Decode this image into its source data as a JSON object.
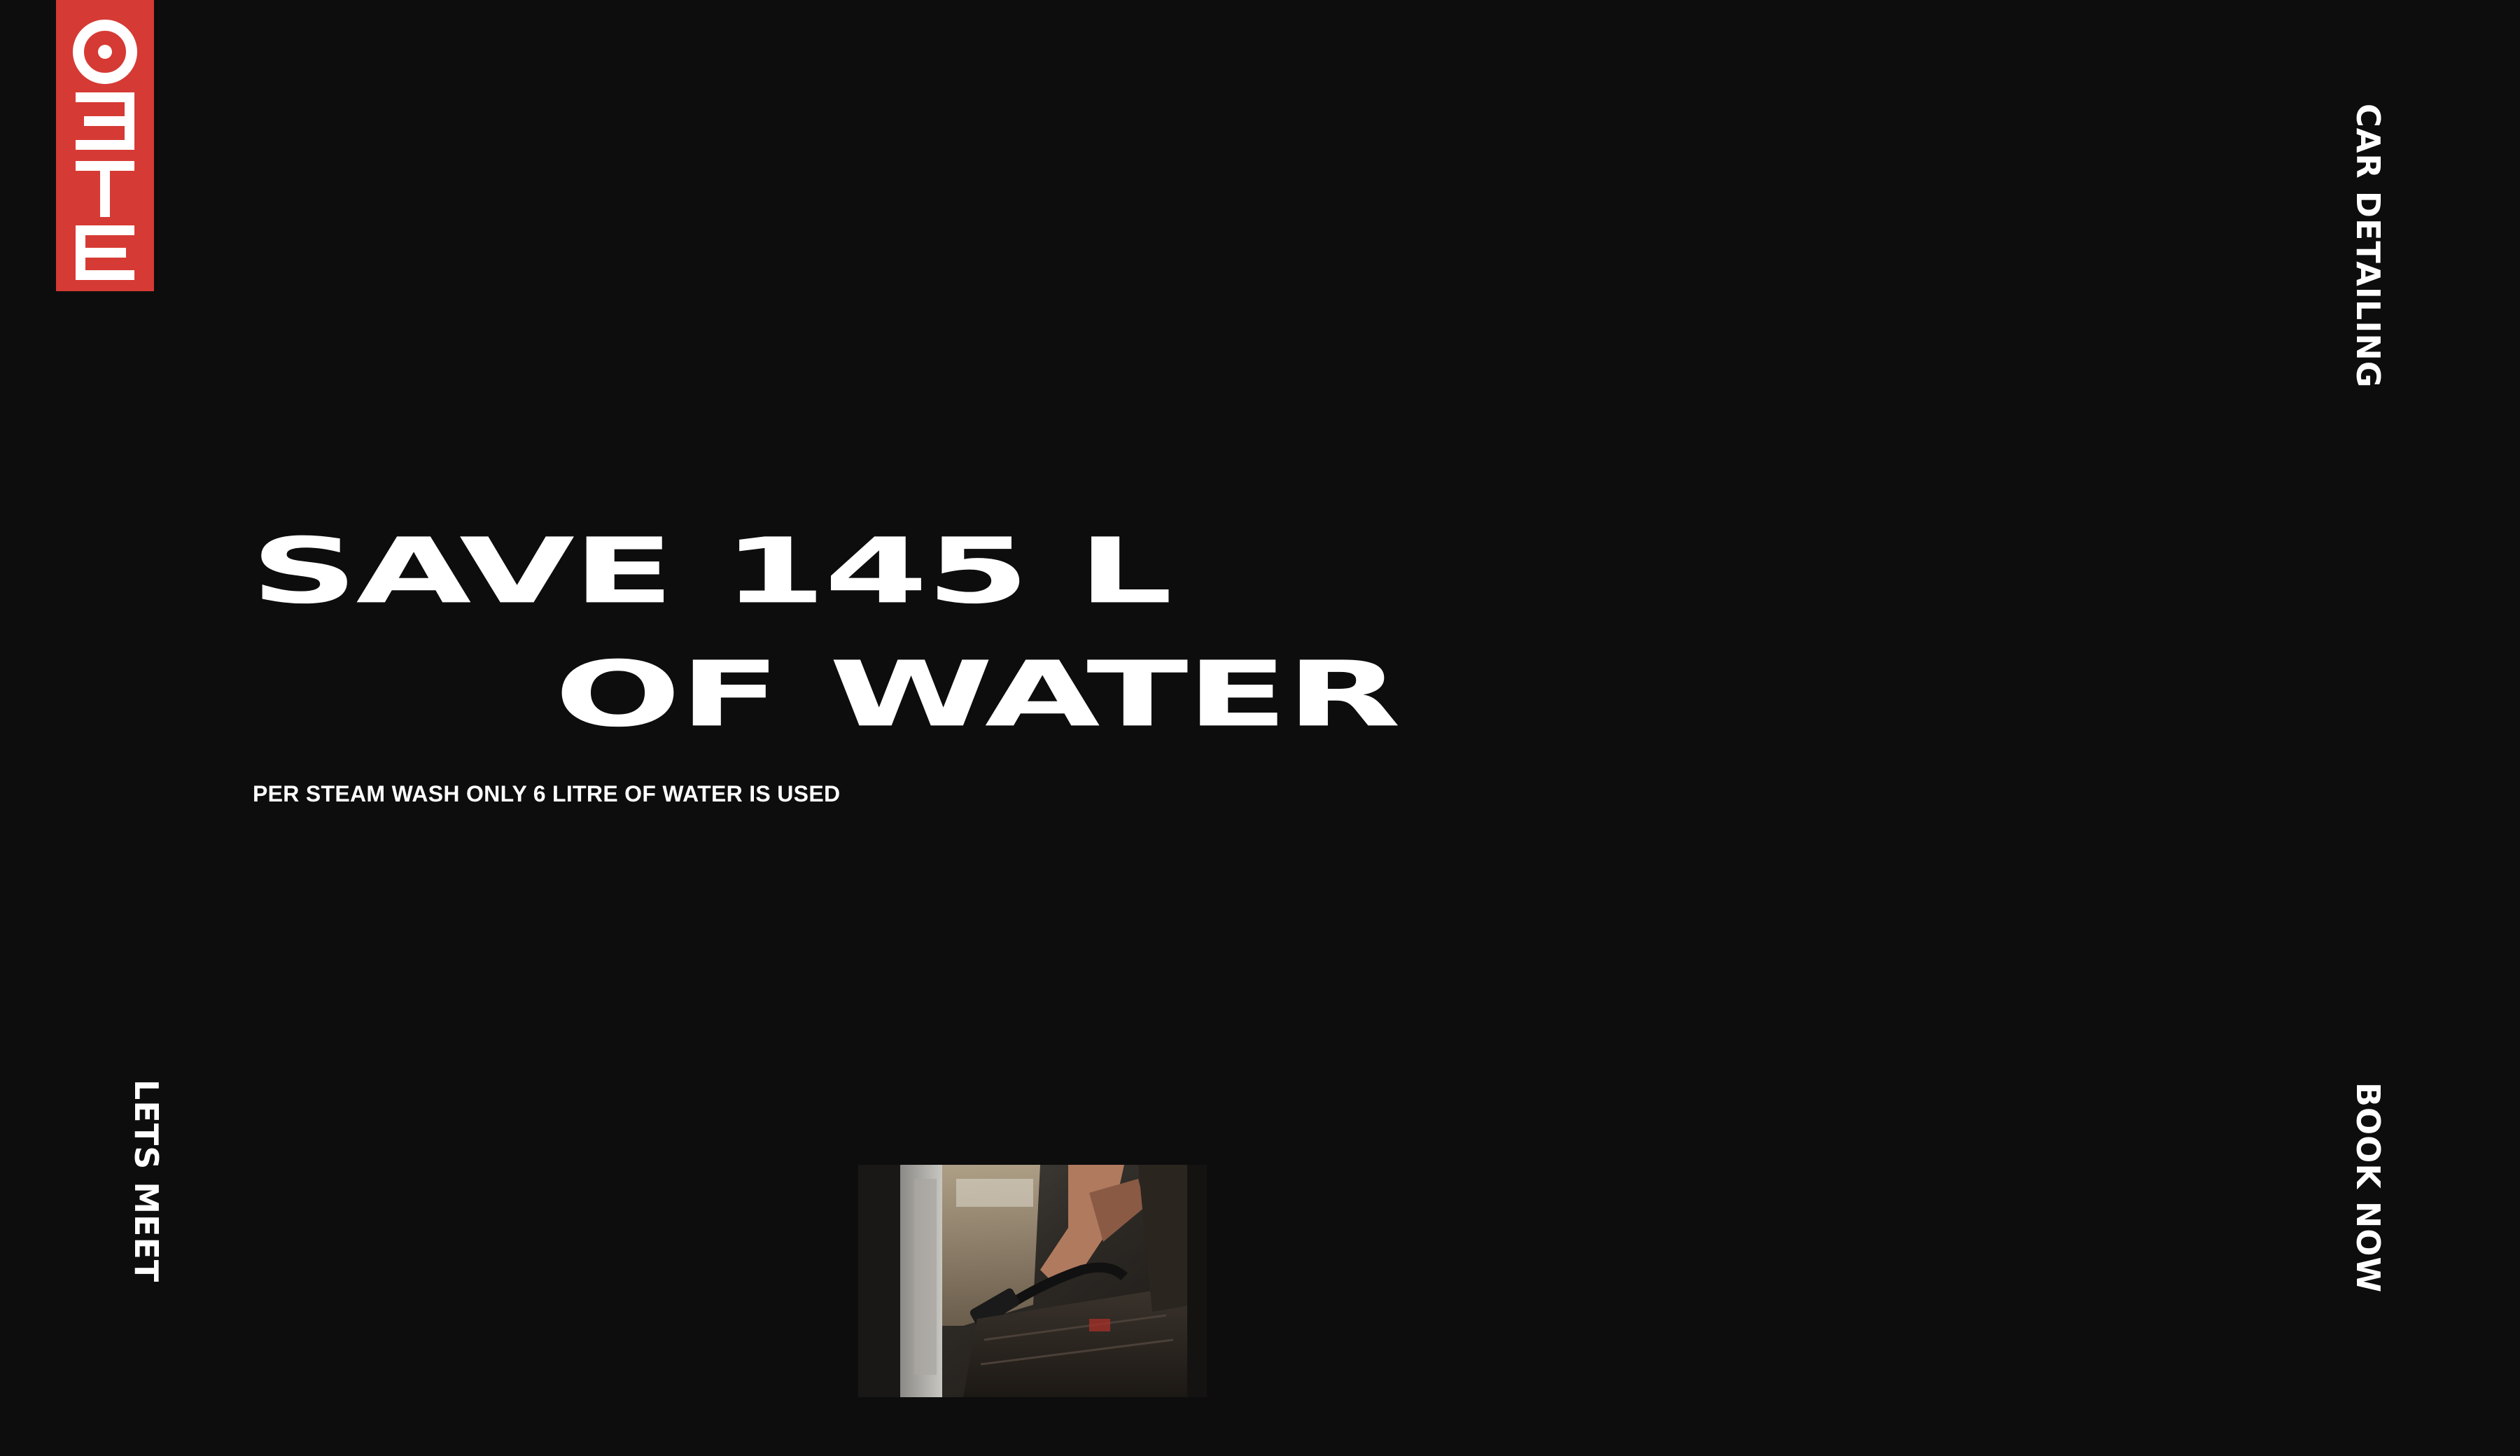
{
  "brand": {
    "logo_text": "OETE",
    "logo_color": "#d63a34"
  },
  "nav": {
    "top_right": "CAR DETAILING",
    "bottom_left": "LETS MEET",
    "bottom_right": "BOOK NOW"
  },
  "hero": {
    "headline_line1": "SAVE 145 L",
    "headline_line2": "OF WATER",
    "subtext": "PER STEAM WASH ONLY 6 LITRE OF WATER IS USED"
  },
  "colors": {
    "background": "#0d0d0d",
    "text": "#ffffff",
    "accent": "#d63a34"
  },
  "icons": {
    "photo": "car-interior-cleaning-image"
  }
}
